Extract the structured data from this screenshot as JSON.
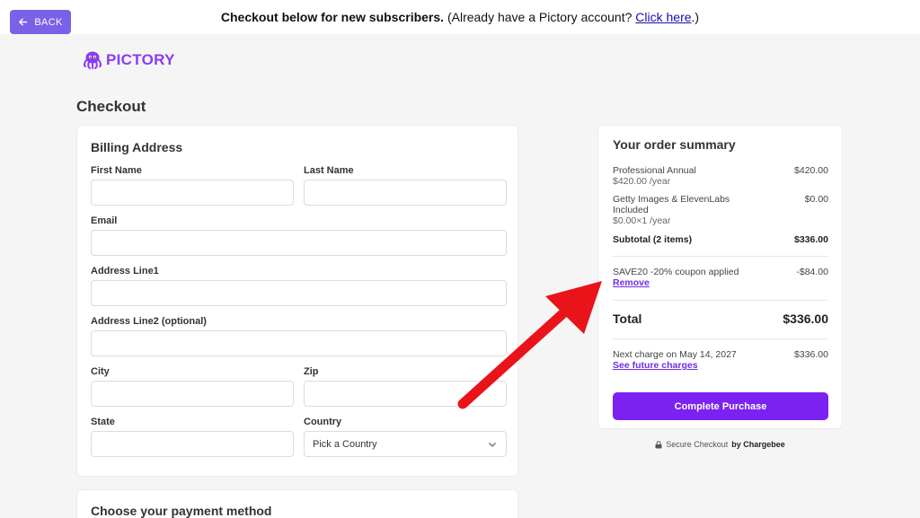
{
  "topbar": {
    "back_label": "BACK",
    "banner_bold": "Checkout below for new subscribers.",
    "banner_text": " (Already have a Pictory account? ",
    "banner_link": "Click here",
    "banner_end": ".)"
  },
  "logo": {
    "text": "PICTORY"
  },
  "page": {
    "title": "Checkout"
  },
  "billing": {
    "title": "Billing Address",
    "first_name_label": "First Name",
    "last_name_label": "Last Name",
    "email_label": "Email",
    "address1_label": "Address Line1",
    "address2_label": "Address Line2 (optional)",
    "city_label": "City",
    "zip_label": "Zip",
    "state_label": "State",
    "country_label": "Country",
    "country_value": "Pick a Country"
  },
  "payment": {
    "title": "Choose your payment method"
  },
  "summary": {
    "title": "Your order summary",
    "item1_name": "Professional Annual",
    "item1_price": "$420.00",
    "item1_sub": "$420.00 /year",
    "item2_name_line1": "Getty Images & ElevenLabs",
    "item2_name_line2": "Included",
    "item2_price": "$0.00",
    "item2_sub": "$0.00×1 /year",
    "subtotal_label": "Subtotal (2 items)",
    "subtotal_value": "$336.00",
    "coupon_label": "SAVE20 -20% coupon applied",
    "coupon_value": "-$84.00",
    "remove_label": "Remove",
    "total_label": "Total",
    "total_value": "$336.00",
    "next_charge_label": "Next charge on May 14, 2027",
    "next_charge_value": "$336.00",
    "future_link": "See future charges",
    "purchase_button": "Complete Purchase"
  },
  "secure": {
    "text": "Secure Checkout",
    "by": "by Chargebee"
  },
  "colors": {
    "accent": "#7b22f2",
    "back_button": "#7b61e8",
    "arrow": "#e8141a"
  }
}
